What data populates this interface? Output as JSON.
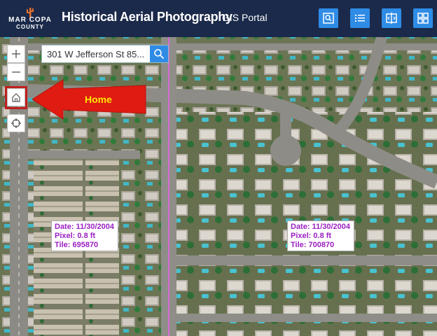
{
  "header": {
    "logo_top": "MAR COPA",
    "logo_bottom": "COUNTY",
    "title": "Historical Aerial Photography",
    "portal_link": "GIS Portal",
    "buttons": [
      {
        "icon": "search-panel-icon"
      },
      {
        "icon": "list-icon"
      },
      {
        "icon": "swipe-compare-icon"
      },
      {
        "icon": "grid-icon"
      }
    ]
  },
  "map_controls": {
    "zoom_in": "+",
    "zoom_out": "—"
  },
  "search": {
    "value": "301 W Jefferson St 85..."
  },
  "callout": {
    "label": "Home"
  },
  "info_boxes": [
    {
      "date": "Date: 11/30/2004",
      "pixel": "Pixel: 0.8 ft",
      "tile": "Tile: 695870"
    },
    {
      "date": "Date: 11/30/2004",
      "pixel": "Pixel: 0.8 ft",
      "tile": "Tile: 700870"
    }
  ],
  "colors": {
    "header_bg": "#1b2a4a",
    "button_blue": "#2f8ce6",
    "swipe_line": "#d86bd8",
    "info_text": "#9b1fc2",
    "callout_arrow": "#e01b12",
    "callout_text": "#ffe600"
  }
}
